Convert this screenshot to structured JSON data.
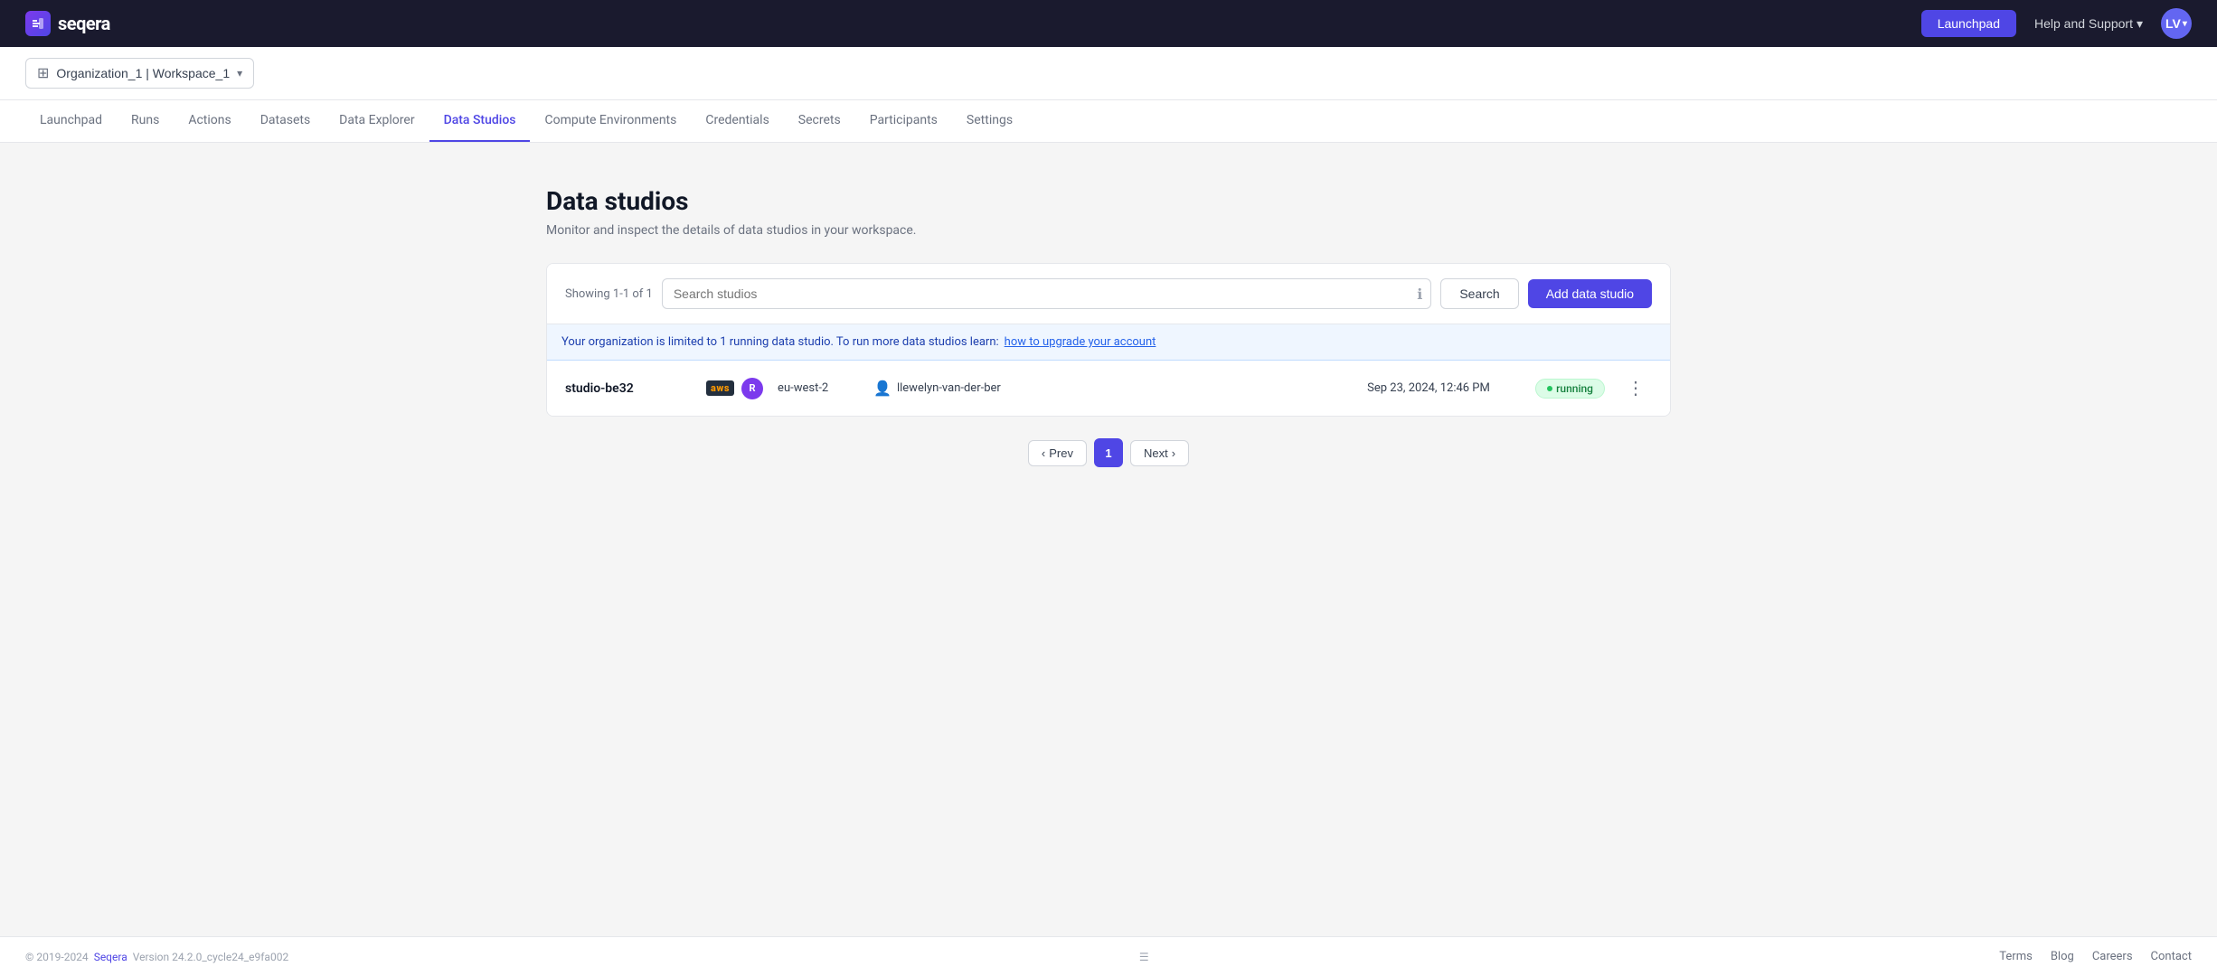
{
  "topnav": {
    "logo_text": "seqera",
    "logo_icon_text": "S",
    "launchpad_btn": "Launchpad",
    "help_support_label": "Help and Support",
    "avatar_initials": "LV"
  },
  "workspace": {
    "label": "Organization_1 | Workspace_1"
  },
  "mainnav": {
    "tabs": [
      {
        "id": "launchpad",
        "label": "Launchpad",
        "active": false
      },
      {
        "id": "runs",
        "label": "Runs",
        "active": false
      },
      {
        "id": "actions",
        "label": "Actions",
        "active": false
      },
      {
        "id": "datasets",
        "label": "Datasets",
        "active": false
      },
      {
        "id": "data-explorer",
        "label": "Data Explorer",
        "active": false
      },
      {
        "id": "data-studios",
        "label": "Data Studios",
        "active": true
      },
      {
        "id": "compute-environments",
        "label": "Compute Environments",
        "active": false
      },
      {
        "id": "credentials",
        "label": "Credentials",
        "active": false
      },
      {
        "id": "secrets",
        "label": "Secrets",
        "active": false
      },
      {
        "id": "participants",
        "label": "Participants",
        "active": false
      },
      {
        "id": "settings",
        "label": "Settings",
        "active": false
      }
    ]
  },
  "page": {
    "title": "Data studios",
    "subtitle": "Monitor and inspect the details of data studios in your workspace.",
    "showing_text": "Showing 1-1 of 1",
    "search_placeholder": "Search studios",
    "search_btn_label": "Search",
    "add_btn_label": "Add data studio",
    "info_banner_text": "Your organization is limited to 1 running data studio. To run more data studios learn:",
    "info_banner_link_text": "how to upgrade your account",
    "info_banner_link_href": "#"
  },
  "studios": [
    {
      "name": "studio-be32",
      "provider": "aws",
      "provider_label": "aws",
      "container_label": "R",
      "region": "eu-west-2",
      "user": "llewelyn-van-der-ber",
      "date": "Sep 23, 2024, 12:46 PM",
      "status": "running"
    }
  ],
  "pagination": {
    "prev_label": "Prev",
    "next_label": "Next",
    "current_page": "1"
  },
  "footer": {
    "copyright": "© 2019-2024",
    "seqera_label": "Seqera",
    "version_text": "Version 24.2.0_cycle24_e9fa002",
    "links": [
      {
        "id": "terms",
        "label": "Terms"
      },
      {
        "id": "blog",
        "label": "Blog"
      },
      {
        "id": "careers",
        "label": "Careers"
      },
      {
        "id": "contact",
        "label": "Contact"
      }
    ]
  }
}
